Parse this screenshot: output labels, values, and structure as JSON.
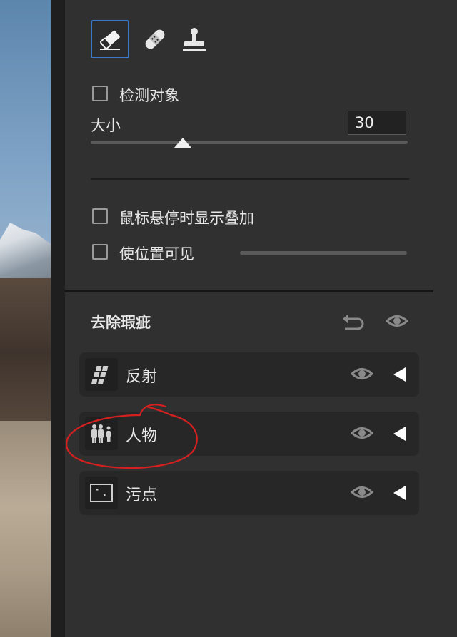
{
  "tools": [
    {
      "name": "eraser-icon",
      "active": true
    },
    {
      "name": "bandage-icon",
      "active": false
    },
    {
      "name": "stamp-icon",
      "active": false
    }
  ],
  "detect_objects": {
    "label": "检测对象",
    "checked": false
  },
  "size": {
    "label": "大小",
    "value": "30",
    "slider_fraction": 0.29
  },
  "hover_overlay": {
    "label": "鼠标悬停时显示叠加",
    "checked": false
  },
  "show_location": {
    "label": "使位置可见",
    "checked": false
  },
  "section": {
    "title": "去除瑕疵",
    "items": [
      {
        "label": "反射",
        "icon": "reflection-icon"
      },
      {
        "label": "人物",
        "icon": "people-icon"
      },
      {
        "label": "污点",
        "icon": "spot-icon"
      }
    ]
  },
  "colors": {
    "panel_bg": "#303030",
    "active_border": "#3a78c8",
    "annotation": "#d42020"
  }
}
